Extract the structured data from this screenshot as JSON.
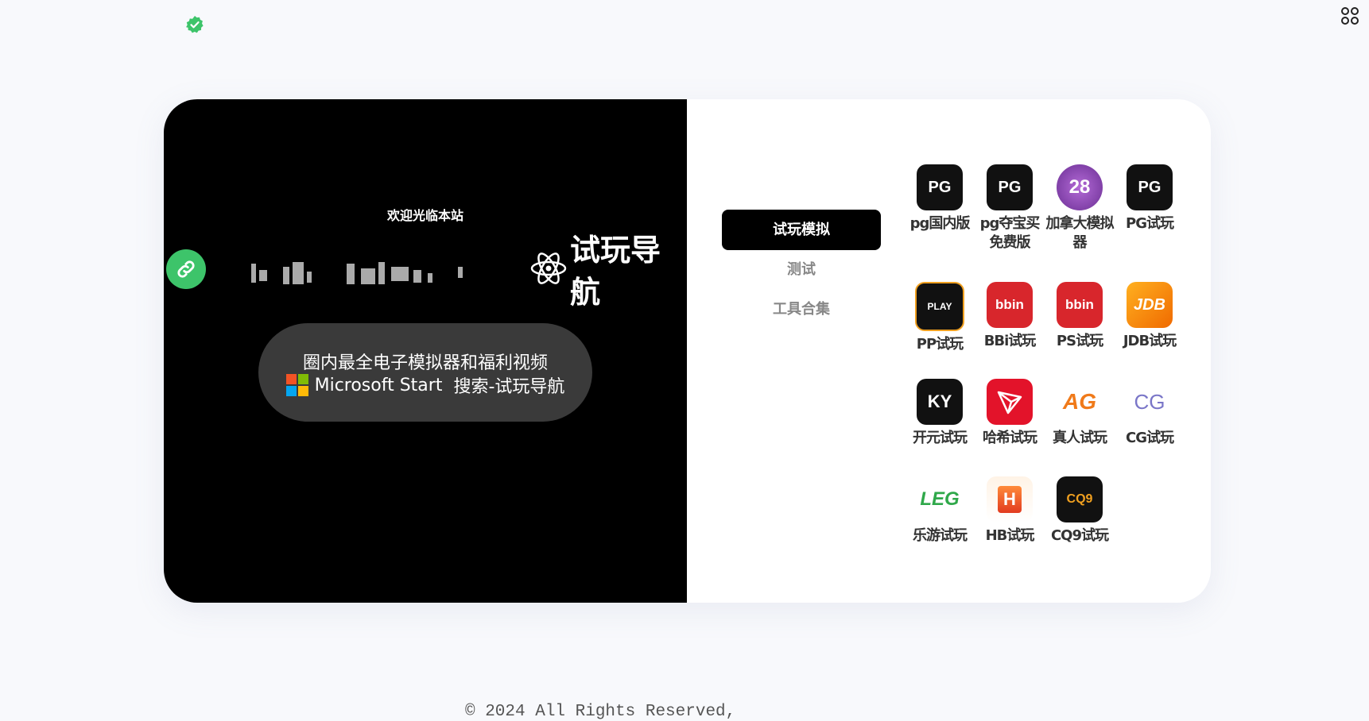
{
  "header": {
    "badge_icon": "verified-check-icon",
    "apps_icon": "apps-grid-icon"
  },
  "hero": {
    "welcome": "欢迎光临本站",
    "title": "试玩导航",
    "pill_line1": "圈内最全电子模拟器和福利视频",
    "pill_brand": "Microsoft Start",
    "pill_search": "搜索-试玩导航"
  },
  "menu": {
    "items": [
      {
        "label": "试玩模拟"
      },
      {
        "label": "测试"
      },
      {
        "label": "工具合集"
      }
    ]
  },
  "games": [
    {
      "label": "pg国内版",
      "icon_text": "PG"
    },
    {
      "label": "pg夺宝买免费版",
      "icon_text": "PG"
    },
    {
      "label": "加拿大模拟器",
      "icon_text": "28"
    },
    {
      "label": "PG试玩",
      "icon_text": "PG"
    },
    {
      "label": "PP试玩",
      "icon_text": "PLAY"
    },
    {
      "label": "BBi试玩",
      "icon_text": "bbin"
    },
    {
      "label": "PS试玩",
      "icon_text": "bbin"
    },
    {
      "label": "JDB试玩",
      "icon_text": "JDB"
    },
    {
      "label": "开元试玩",
      "icon_text": "KY"
    },
    {
      "label": "哈希试玩",
      "icon_text": ""
    },
    {
      "label": "真人试玩",
      "icon_text": "AG"
    },
    {
      "label": "CG试玩",
      "icon_text": "CG"
    },
    {
      "label": "乐游试玩",
      "icon_text": "LEG"
    },
    {
      "label": "HB试玩",
      "icon_text": "H"
    },
    {
      "label": "CQ9试玩",
      "icon_text": "CQ9"
    }
  ],
  "footer": {
    "text": "© 2024 All Rights Reserved,"
  },
  "colors": {
    "accent_green": "#3dc46a",
    "dark": "#000000",
    "red": "#d8262c"
  }
}
